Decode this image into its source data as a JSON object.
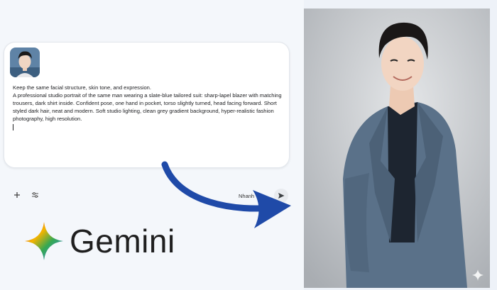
{
  "prompt": {
    "line1": "Keep the same facial structure, skin tone, and expression.",
    "line2": "A professional studio portrait of the same man wearing a slate-blue tailored suit: sharp-lapel blazer with matching trousers, dark shirt inside. Confident pose, one hand in pocket, torso slightly turned, head facing forward. Short styled dark hair, neat and modern. Soft studio lighting, clean grey gradient background, hyper-realistic fashion photography, high resolution."
  },
  "toolbar": {
    "add_icon": "plus-icon",
    "tools_icon": "sliders-icon",
    "model_label": "Nhanh",
    "send_icon": "send-icon"
  },
  "logo": {
    "wordmark": "Gemini"
  },
  "colors": {
    "arrow": "#1f4aa8",
    "suit": "#5a7189",
    "background_grey": "#c9ccd0"
  }
}
